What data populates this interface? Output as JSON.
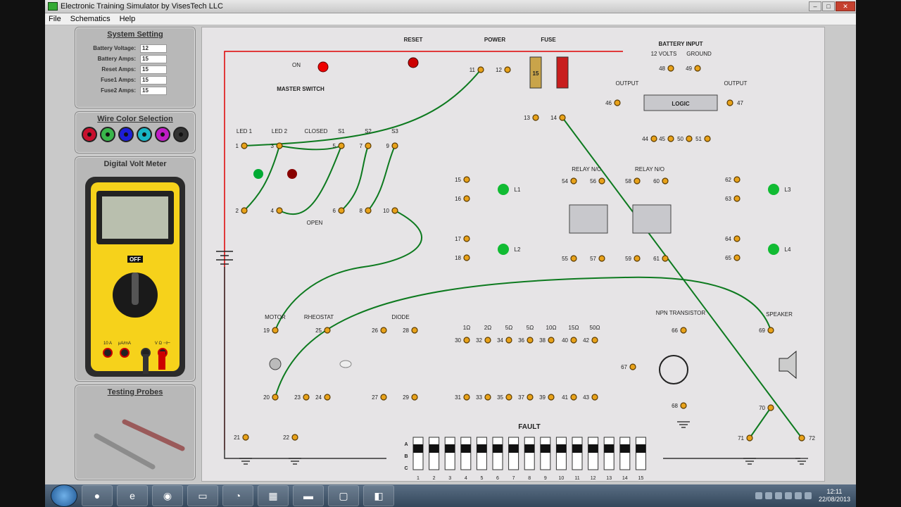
{
  "window": {
    "title": "Electronic Training Simulator by VisesTech LLC"
  },
  "menu": [
    "File",
    "Schematics",
    "Help"
  ],
  "system_setting": {
    "title": "System Setting",
    "rows": [
      {
        "label": "Battery Voltage:",
        "value": "12"
      },
      {
        "label": "Battery Amps:",
        "value": "15"
      },
      {
        "label": "Reset Amps:",
        "value": "15"
      },
      {
        "label": "Fuse1 Amps:",
        "value": "15"
      },
      {
        "label": "Fuse2 Amps:",
        "value": "15"
      }
    ]
  },
  "wire_color": {
    "title": "Wire Color Selection",
    "colors": [
      "#c8102e",
      "#39b54a",
      "#1d1dd6",
      "#18b5c5",
      "#c01cc6",
      "#333333"
    ]
  },
  "dvm": {
    "title": "Digital Volt Meter",
    "off": "OFF",
    "ports": [
      "10 A",
      "μA/mA",
      "V Ω ⊣⊢"
    ]
  },
  "probes": {
    "title": "Testing Probes"
  },
  "board": {
    "master_switch": "MASTER SWITCH",
    "on": "ON",
    "reset": "RESET",
    "power": "POWER",
    "fuse": "FUSE",
    "fuse1": "15",
    "battery_input": "BATTERY INPUT",
    "volts": "12 VOLTS",
    "ground": "GROUND",
    "output": "OUTPUT",
    "logic": "LOGIC",
    "led1": "LED 1",
    "led2": "LED 2",
    "closed": "CLOSED",
    "open": "OPEN",
    "s1": "S1",
    "s2": "S2",
    "s3": "S3",
    "relay_nc": "RELAY N/C",
    "relay_no": "RELAY N/O",
    "l1": "L1",
    "l2": "L2",
    "l3": "L3",
    "l4": "L4",
    "motor": "MOTOR",
    "rheostat": "RHEOSTAT",
    "diode": "DIODE",
    "npn": "NPN TRANSISTOR",
    "speaker": "SPEAKER",
    "fault": "FAULT",
    "fault_rows": [
      "A",
      "B",
      "C"
    ],
    "fault_cols": [
      "1",
      "2",
      "3",
      "4",
      "5",
      "6",
      "7",
      "8",
      "9",
      "10",
      "11",
      "12",
      "13",
      "14",
      "15"
    ],
    "resistors": [
      "1Ω",
      "2Ω",
      "5Ω",
      "5Ω",
      "10Ω",
      "15Ω",
      "50Ω"
    ],
    "nodes": [
      "1",
      "2",
      "3",
      "4",
      "5",
      "6",
      "7",
      "8",
      "9",
      "10",
      "11",
      "12",
      "13",
      "14",
      "15",
      "16",
      "17",
      "18",
      "19",
      "20",
      "21",
      "22",
      "23",
      "24",
      "25",
      "26",
      "27",
      "28",
      "29",
      "30",
      "31",
      "32",
      "33",
      "34",
      "35",
      "36",
      "37",
      "38",
      "39",
      "40",
      "41",
      "42",
      "43",
      "44",
      "45",
      "46",
      "47",
      "48",
      "49",
      "50",
      "51",
      "54",
      "55",
      "56",
      "57",
      "58",
      "59",
      "60",
      "61",
      "62",
      "63",
      "64",
      "65",
      "66",
      "67",
      "68",
      "69",
      "70",
      "71",
      "72"
    ]
  },
  "taskbar": {
    "time": "12:11",
    "date": "22/08/2013"
  }
}
